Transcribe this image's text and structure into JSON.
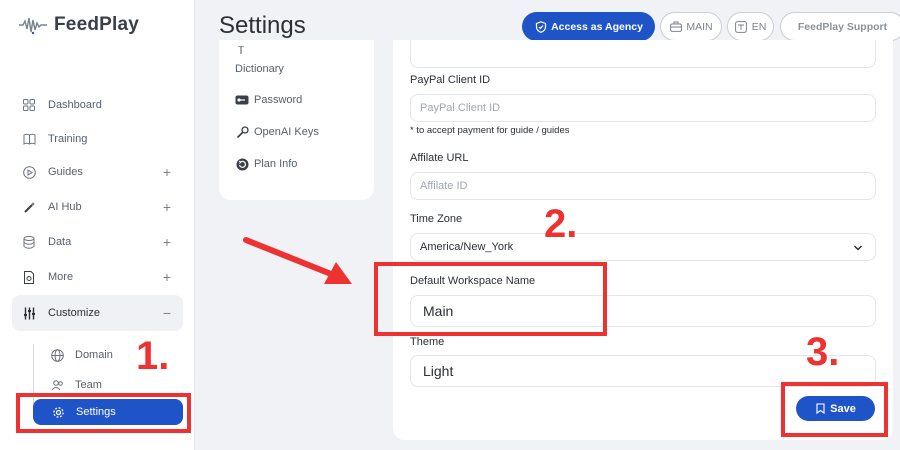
{
  "app": {
    "name": "FeedPlay"
  },
  "header": {
    "title": "Settings",
    "agency_button": "Access as Agency",
    "workspace_button": "MAIN",
    "language_button": "EN",
    "support_button": "FeedPlay Support"
  },
  "sidebar": {
    "items": [
      {
        "label": "Dashboard",
        "icon": "grid-icon"
      },
      {
        "label": "Training",
        "icon": "book-icon"
      },
      {
        "label": "Guides",
        "icon": "play-circle-icon",
        "expand": "+"
      },
      {
        "label": "AI Hub",
        "icon": "magic-wand-icon",
        "expand": "+"
      },
      {
        "label": "Data",
        "icon": "database-icon",
        "expand": "+"
      },
      {
        "label": "More",
        "icon": "file-icon",
        "expand": "+"
      },
      {
        "label": "Customize",
        "icon": "sliders-icon",
        "expand": "−"
      }
    ],
    "sub_items": [
      {
        "label": "Domain",
        "icon": "globe-icon"
      },
      {
        "label": "Team",
        "icon": "users-icon"
      },
      {
        "label": "Settings",
        "icon": "gear-icon"
      }
    ]
  },
  "settings_menu": {
    "items": [
      {
        "label": "Dictionary",
        "icon": "translate-icon"
      },
      {
        "label": "Password",
        "icon": "key-icon"
      },
      {
        "label": "OpenAI Keys",
        "icon": "wrench-icon"
      },
      {
        "label": "Plan Info",
        "icon": "refresh-icon"
      }
    ]
  },
  "form": {
    "paypal_label": "PayPal Client ID",
    "paypal_placeholder": "PayPal Client ID",
    "paypal_hint": "* to accept payment for guide / guides",
    "affiliate_label": "Affilate URL",
    "affiliate_placeholder": "Affilate ID",
    "timezone_label": "Time Zone",
    "timezone_value": "America/New_York",
    "workspace_label": "Default Workspace Name",
    "workspace_value": "Main",
    "theme_label": "Theme",
    "theme_value": "Light",
    "save_label": "Save"
  },
  "annotations": {
    "step1": "1.",
    "step2": "2.",
    "step3": "3.",
    "color": "#ee3131"
  },
  "colors": {
    "accent": "#1f54c9"
  }
}
